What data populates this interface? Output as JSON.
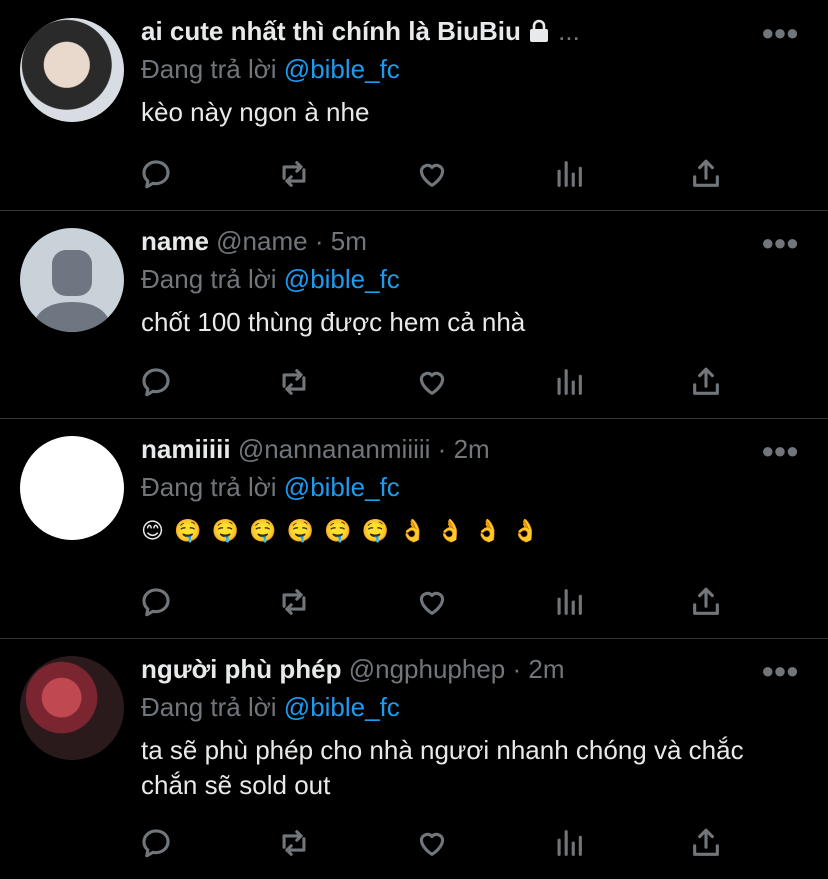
{
  "tweets": [
    {
      "display_name": "ai cute nhất thì chính là BiuBiu",
      "handle": "",
      "sep": "",
      "time": "",
      "ellipsis": "...",
      "reply_prefix": "Đang trả lời",
      "reply_to": "@bible_fc",
      "text": "kèo này ngon à nhe",
      "avatar": "photo-boy",
      "locked": true
    },
    {
      "display_name": "name",
      "handle": "@name",
      "sep": "·",
      "time": "5m",
      "reply_prefix": "Đang trả lời",
      "reply_to": "@bible_fc",
      "text": "chốt 100 thùng được hem cả nhà",
      "avatar": "default-avatar"
    },
    {
      "display_name": "namiiiii",
      "handle": "@nannananmiiiii",
      "sep": "·",
      "time": "2m",
      "reply_prefix": "Đang trả lời",
      "reply_to": "@bible_fc",
      "text": "😊 🤤 🤤 🤤 🤤 🤤 🤤 👌 👌 👌 👌",
      "avatar": "blank-white"
    },
    {
      "display_name": "người phù phép",
      "handle": "@ngphuphep",
      "sep": "·",
      "time": "2m",
      "reply_prefix": "Đang trả lời",
      "reply_to": "@bible_fc",
      "text": "ta sẽ phù phép cho nhà ngươi nhanh chóng và chắc chắn sẽ sold out",
      "avatar": "rose-photo"
    }
  ],
  "icons": {
    "more": "more-icon",
    "reply": "reply-icon",
    "retweet": "retweet-icon",
    "like": "like-icon",
    "analytics": "analytics-icon",
    "share": "share-icon",
    "lock": "lock-icon"
  },
  "colors": {
    "background": "#000000",
    "text": "#e7e9ea",
    "muted": "#71767b",
    "accent": "#1d9bf0",
    "divider": "#2f3336"
  }
}
